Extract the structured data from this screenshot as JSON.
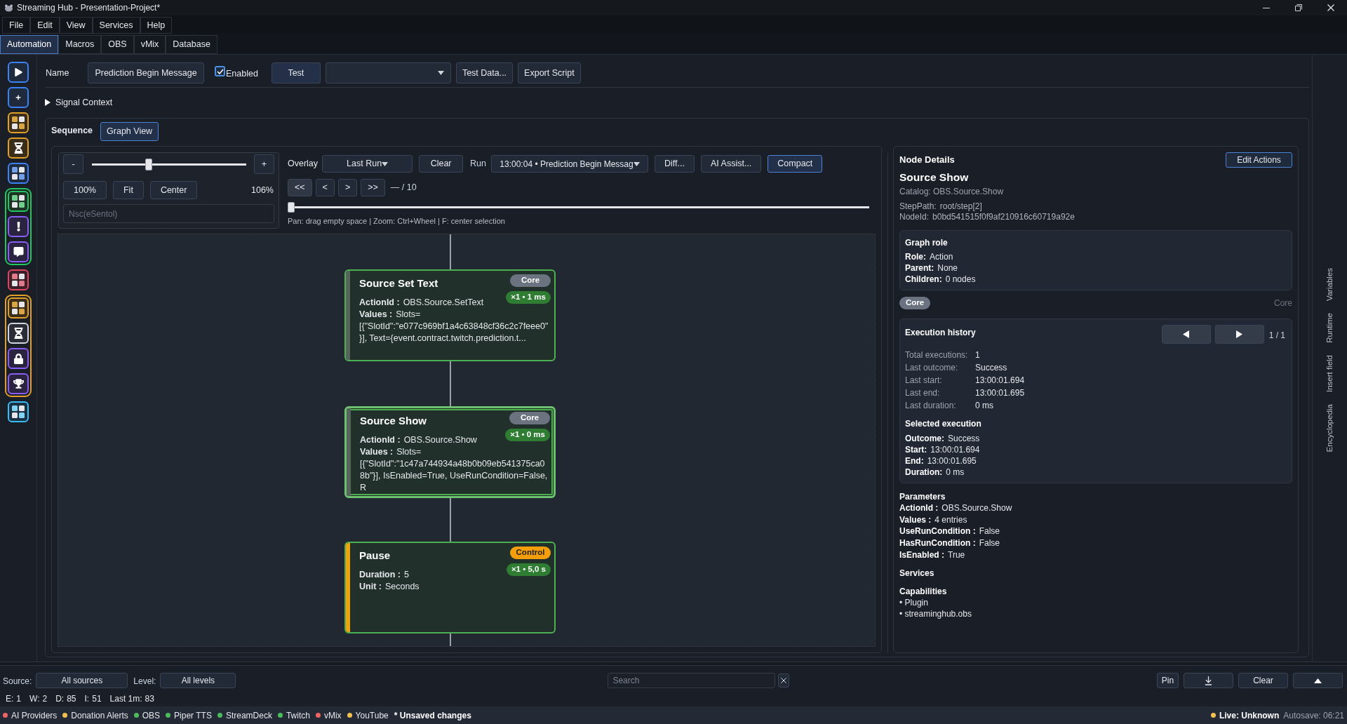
{
  "window": {
    "title": "Streaming Hub - Presentation-Project*"
  },
  "menu": [
    "File",
    "Edit",
    "View",
    "Services",
    "Help"
  ],
  "tabs": [
    {
      "label": "Automation",
      "selected": true
    },
    {
      "label": "Macros",
      "selected": false
    },
    {
      "label": "OBS",
      "selected": false
    },
    {
      "label": "vMix",
      "selected": false
    },
    {
      "label": "Database",
      "selected": false
    }
  ],
  "editor": {
    "name_label": "Name",
    "name_value": "Prediction Begin Message",
    "enabled": {
      "label": "Enabled",
      "checked": true
    },
    "test_button": "Test",
    "more_buttons": [
      "Test Data...",
      "Export Script"
    ],
    "signal_context": {
      "label": "Signal Context",
      "expanded": false
    },
    "sequence_label": "Sequence",
    "view_toggle": {
      "label": "Graph View",
      "selected": true
    }
  },
  "graph_controls": {
    "zoom_out": "-",
    "zoom_in": "+",
    "zoom": {
      "level": 0.36
    },
    "zoom_buttons": [
      "100%",
      "Fit",
      "Center"
    ],
    "zoom_reading": "106%",
    "search": {
      "placeholder": "Nsc(eSentol)"
    },
    "overlay": {
      "label": "Overlay",
      "value": "Last Run"
    },
    "clear": "Clear",
    "run": {
      "label": "Run",
      "value": "13:00:04 • Prediction Begin Messag"
    },
    "tools": [
      {
        "label": "Diff...",
        "selected": false
      },
      {
        "label": "AI Assist...",
        "selected": false
      },
      {
        "label": "Compact",
        "selected": true
      }
    ],
    "step_buttons": [
      "<<",
      "<",
      ">",
      ">>"
    ],
    "step_reading": "— / 10",
    "timeline": {
      "level": 0
    },
    "hint": "Pan: drag empty space | Zoom: Ctrl+Wheel | F: center selection"
  },
  "graph": {
    "nodes": [
      {
        "title": "Source Set Text",
        "kind": "core",
        "badge": "Core",
        "stats": "×1 • 1 ms",
        "selected": false,
        "fields": [
          {
            "label": "ActionId :",
            "value": "OBS.Source.SetText"
          },
          {
            "label": "Values :",
            "value": "Slots=[{\"SlotId\":\"e077c969bf1a4c63848cf36c2c7feee0\"}], Text={event.contract.twitch.prediction.t..."
          }
        ]
      },
      {
        "title": "Source Show",
        "kind": "core",
        "badge": "Core",
        "stats": "×1 • 0 ms",
        "selected": true,
        "fields": [
          {
            "label": "ActionId :",
            "value": "OBS.Source.Show"
          },
          {
            "label": "Values :",
            "value": "Slots=[{\"SlotId\":\"1c47a744934a48b0b09eb541375ca08b\"}], IsEnabled=True, UseRunCondition=False, R"
          }
        ]
      },
      {
        "title": "Pause",
        "kind": "control",
        "badge": "Control",
        "stats": "×1 • 5,0 s",
        "selected": false,
        "fields": [
          {
            "label": "Duration :",
            "value": "5"
          },
          {
            "label": "Unit :",
            "value": "Seconds"
          }
        ]
      }
    ]
  },
  "details": {
    "title": "Node Details",
    "edit_button": "Edit Actions",
    "node_title": "Source Show",
    "catalog": "Catalog: OBS.Source.Show",
    "meta": [
      {
        "label": "StepPath:",
        "value": "root/step[2]"
      },
      {
        "label": "NodeId:",
        "value": "b0bd541515f0f9af210916c60719a92e"
      }
    ],
    "graph_role": {
      "title": "Graph role",
      "rows": [
        {
          "label": "Role:",
          "value": "Action"
        },
        {
          "label": "Parent:",
          "value": "None"
        },
        {
          "label": "Children:",
          "value": "0 nodes"
        }
      ]
    },
    "category_badge": "Core",
    "category_text": "Core",
    "execution_history": {
      "title": "Execution history",
      "page": "1 / 1",
      "stats": [
        {
          "label": "Total executions:",
          "value": "1"
        },
        {
          "label": "Last outcome:",
          "value": "Success"
        },
        {
          "label": "Last start:",
          "value": "13:00:01.694"
        },
        {
          "label": "Last end:",
          "value": "13:00:01.695"
        },
        {
          "label": "Last duration:",
          "value": "0 ms"
        }
      ],
      "selected_title": "Selected execution",
      "selected_rows": [
        {
          "label": "Outcome:",
          "value": "Success"
        },
        {
          "label": "Start:",
          "value": "13:00:01.694"
        },
        {
          "label": "End:",
          "value": "13:00:01.695"
        },
        {
          "label": "Duration:",
          "value": "0 ms"
        }
      ]
    },
    "parameters": {
      "title": "Parameters",
      "rows": [
        {
          "label": "ActionId :",
          "value": "OBS.Source.Show"
        },
        {
          "label": "Values :",
          "value": "4 entries"
        },
        {
          "label": "UseRunCondition :",
          "value": "False"
        },
        {
          "label": "HasRunCondition :",
          "value": "False"
        },
        {
          "label": "IsEnabled :",
          "value": "True"
        }
      ]
    },
    "services_title": "Services",
    "capabilities": {
      "title": "Capabilities",
      "items": [
        "• Plugin",
        "• streaminghub.obs"
      ]
    }
  },
  "side_tabs": [
    "Variables",
    "Runtime",
    "Insert field",
    "Encyclopedia"
  ],
  "log": {
    "source": {
      "label": "Source:",
      "value": "All sources"
    },
    "level": {
      "label": "Level:",
      "value": "All levels"
    },
    "search": {
      "placeholder": "Search"
    },
    "pin": "Pin",
    "clear": "Clear",
    "counts": [
      {
        "label": "E:",
        "value": "1"
      },
      {
        "label": "W:",
        "value": "2"
      },
      {
        "label": "D:",
        "value": "85"
      },
      {
        "label": "I:",
        "value": "51"
      },
      {
        "label": "Last 1m:",
        "value": "83"
      }
    ]
  },
  "status_bar": {
    "services": [
      {
        "name": "AI Providers",
        "color": "#ef6464"
      },
      {
        "name": "Donation Alerts",
        "color": "#f4c150"
      },
      {
        "name": "OBS",
        "color": "#4cbb5c"
      },
      {
        "name": "Piper TTS",
        "color": "#4cbb5c"
      },
      {
        "name": "StreamDeck",
        "color": "#4cbb5c"
      },
      {
        "name": "Twitch",
        "color": "#4cbb5c"
      },
      {
        "name": "vMix",
        "color": "#ef6464"
      },
      {
        "name": "YouTube",
        "color": "#f4c150"
      }
    ],
    "unsaved": "* Unsaved changes",
    "live": {
      "label": "Live: Unknown",
      "color": "#f4c150"
    },
    "autosave": "Autosave: 06:21"
  }
}
